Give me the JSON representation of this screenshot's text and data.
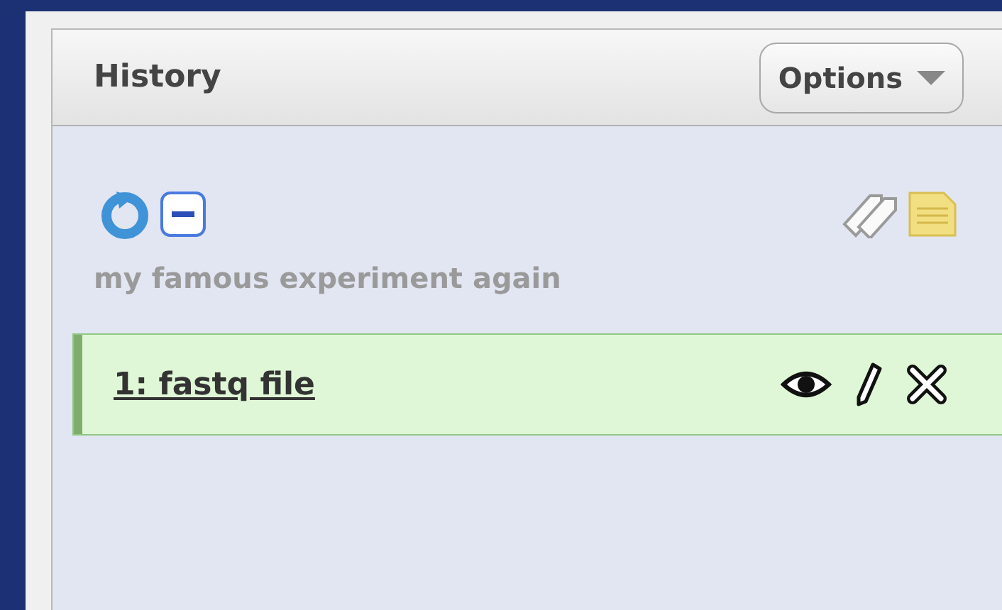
{
  "panel": {
    "title": "History",
    "options_button": "Options"
  },
  "history": {
    "name": "my famous experiment again"
  },
  "datasets": [
    {
      "label": "1: fastq file",
      "kind": "ok"
    }
  ]
}
